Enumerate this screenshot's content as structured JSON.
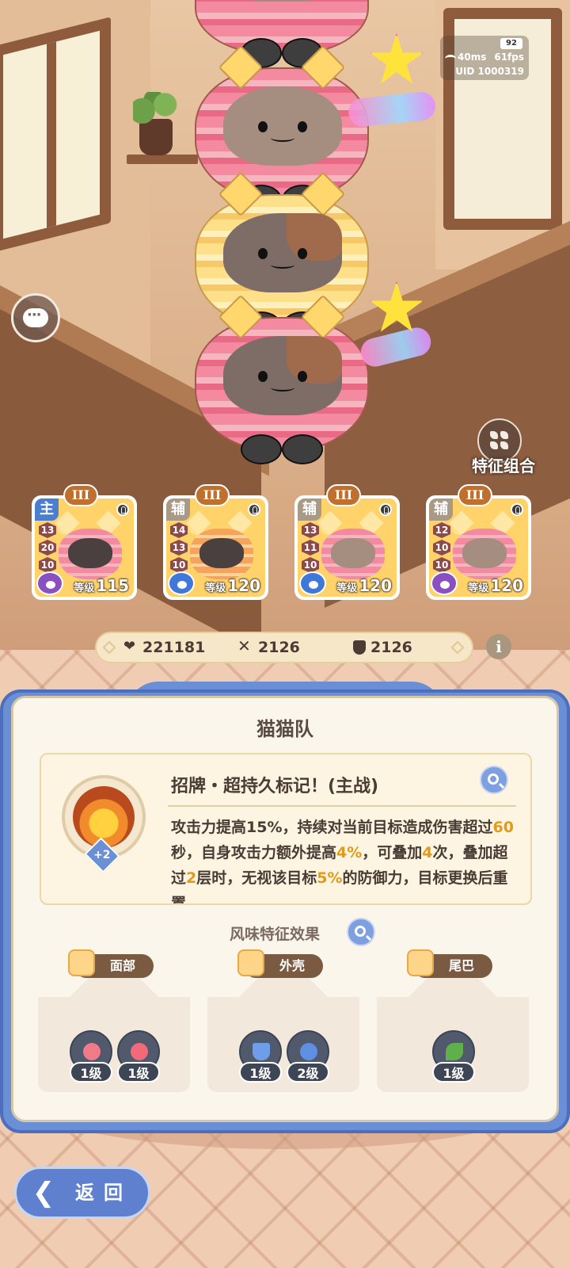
{
  "hud": {
    "battery": "92",
    "ping": "40ms",
    "fps": "61fps",
    "uid": "UID 1000319"
  },
  "side_buttons": {
    "trait_combo_label": "特征组合"
  },
  "team_cards": [
    {
      "role": "主",
      "tier": "III",
      "stats": [
        "13",
        "20",
        "10"
      ],
      "level_label": "等级",
      "level": "115"
    },
    {
      "role": "辅",
      "tier": "III",
      "stats": [
        "14",
        "13",
        "10"
      ],
      "level_label": "等级",
      "level": "120"
    },
    {
      "role": "辅",
      "tier": "III",
      "stats": [
        "13",
        "11",
        "10"
      ],
      "level_label": "等级",
      "level": "120"
    },
    {
      "role": "辅",
      "tier": "III",
      "stats": [
        "12",
        "10",
        "10"
      ],
      "level_label": "等级",
      "level": "120"
    }
  ],
  "team_stats": {
    "hp": "221181",
    "attack": "2126",
    "defense": "2126"
  },
  "panel": {
    "title": "猫猫队",
    "skill": {
      "plus": "+2",
      "name": "招牌・超持久标记！(主战)",
      "desc_parts": [
        "攻击力提高15%，持续对当前目标造成伤害超过",
        "60",
        "秒，自身攻击力额外提高",
        "4%",
        "，可叠加",
        "4",
        "次，叠加超过",
        "2",
        "层时，无视该目标",
        "5%",
        "的防御力，目标更换后重置"
      ]
    },
    "flavor_title": "风味特征效果",
    "traits": [
      {
        "label": "面部",
        "levels": [
          "1级",
          "1级"
        ]
      },
      {
        "label": "外壳",
        "levels": [
          "1级",
          "2级"
        ]
      },
      {
        "label": "尾巴",
        "levels": [
          "1级"
        ]
      }
    ]
  },
  "back_button": {
    "label": "返回"
  },
  "colors": {
    "panel_blue": "#6b8fd6",
    "highlight": "#e39a16",
    "main_role": "#4a7fd0",
    "sub_role": "#a99a88"
  }
}
